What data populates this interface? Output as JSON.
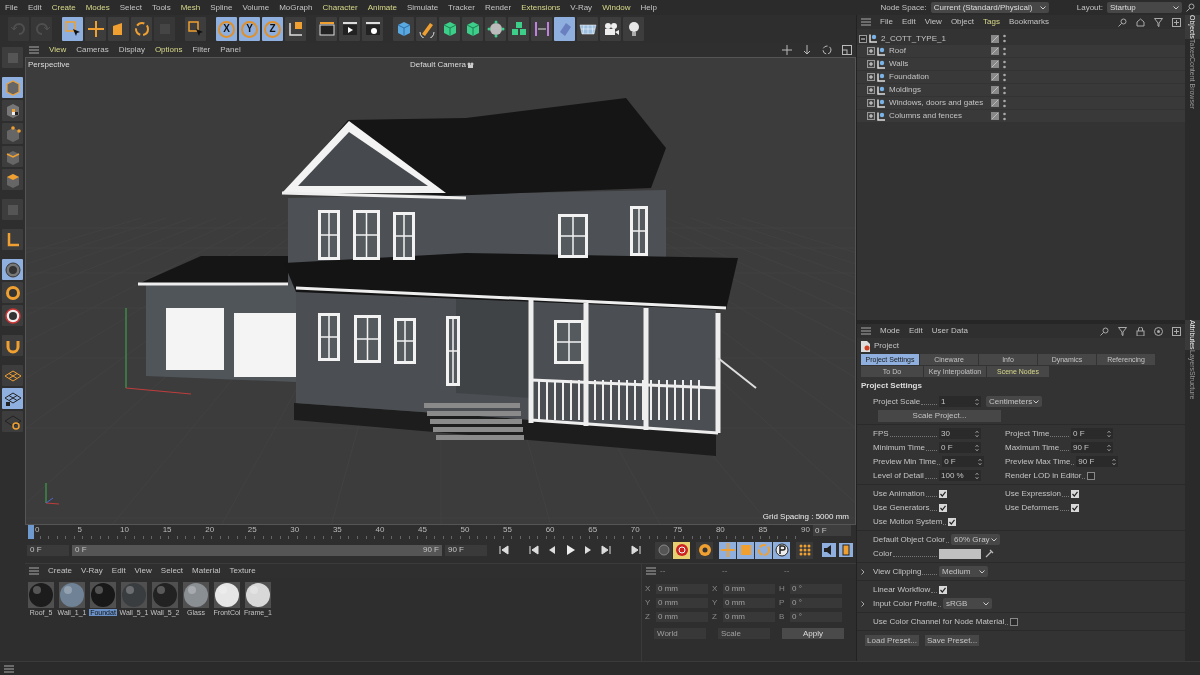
{
  "menu_bar": {
    "items": [
      {
        "label": "File",
        "highlighted": false
      },
      {
        "label": "Edit",
        "highlighted": false
      },
      {
        "label": "Create",
        "highlighted": true
      },
      {
        "label": "Modes",
        "highlighted": true
      },
      {
        "label": "Select",
        "highlighted": false
      },
      {
        "label": "Tools",
        "highlighted": false
      },
      {
        "label": "Mesh",
        "highlighted": true
      },
      {
        "label": "Spline",
        "highlighted": false
      },
      {
        "label": "Volume",
        "highlighted": false
      },
      {
        "label": "MoGraph",
        "highlighted": false
      },
      {
        "label": "Character",
        "highlighted": true
      },
      {
        "label": "Animate",
        "highlighted": true
      },
      {
        "label": "Simulate",
        "highlighted": false
      },
      {
        "label": "Tracker",
        "highlighted": false
      },
      {
        "label": "Render",
        "highlighted": false
      },
      {
        "label": "Extensions",
        "highlighted": true
      },
      {
        "label": "V-Ray",
        "highlighted": false
      },
      {
        "label": "Window",
        "highlighted": true
      },
      {
        "label": "Help",
        "highlighted": false
      }
    ]
  },
  "node_space": {
    "label": "Node Space:",
    "value": "Current (Standard/Physical)"
  },
  "layout": {
    "label": "Layout:",
    "value": "Startup"
  },
  "toolbar": [
    {
      "kind": "undo",
      "selected": false,
      "disabled": true
    },
    {
      "kind": "redo",
      "selected": false,
      "disabled": true
    },
    {
      "kind": "select",
      "selected": true,
      "disabled": false
    },
    {
      "kind": "move",
      "selected": false,
      "disabled": false
    },
    {
      "kind": "scale",
      "selected": false,
      "disabled": false
    },
    {
      "kind": "rotate",
      "selected": false,
      "disabled": false
    },
    {
      "kind": "recent",
      "selected": false,
      "disabled": true
    },
    {
      "kind": "select",
      "selected": false,
      "disabled": false
    },
    {
      "kind": "axis",
      "label": "X",
      "selected": true,
      "disabled": false
    },
    {
      "kind": "axis",
      "label": "Y",
      "selected": true,
      "disabled": false
    },
    {
      "kind": "axis",
      "label": "Z",
      "selected": true,
      "disabled": false
    },
    {
      "kind": "coords",
      "selected": false,
      "disabled": false
    },
    {
      "kind": "clapper",
      "selected": false,
      "disabled": false
    },
    {
      "kind": "render",
      "selected": false,
      "disabled": false
    },
    {
      "kind": "render-settings",
      "selected": false,
      "disabled": false
    },
    {
      "kind": "cube",
      "selected": false,
      "disabled": false
    },
    {
      "kind": "pen",
      "selected": false,
      "disabled": false
    },
    {
      "kind": "green-cube",
      "selected": false,
      "disabled": false
    },
    {
      "kind": "green-cube",
      "selected": false,
      "disabled": false
    },
    {
      "kind": "cloner",
      "selected": false,
      "disabled": false
    },
    {
      "kind": "green-cubes",
      "selected": false,
      "disabled": false
    },
    {
      "kind": "symmetry",
      "selected": false,
      "disabled": false
    },
    {
      "kind": "deformer",
      "selected": true,
      "disabled": false
    },
    {
      "kind": "floor",
      "selected": false,
      "disabled": false
    },
    {
      "kind": "camera",
      "selected": false,
      "disabled": false
    },
    {
      "kind": "light",
      "selected": false,
      "disabled": false
    }
  ],
  "left_toolbar": [
    {
      "kind": "recent",
      "selected": false
    },
    {
      "kind": "model",
      "selected": true
    },
    {
      "kind": "texture",
      "selected": false
    },
    {
      "kind": "points",
      "selected": false
    },
    {
      "kind": "edges",
      "selected": false
    },
    {
      "kind": "polygons",
      "selected": false
    },
    {
      "kind": "recent",
      "selected": false
    },
    {
      "kind": "axis",
      "selected": false
    },
    {
      "kind": "snap-grey",
      "selected": true
    },
    {
      "kind": "snap",
      "selected": false
    },
    {
      "kind": "snap-white",
      "selected": false
    },
    {
      "kind": "magnet",
      "selected": false
    },
    {
      "kind": "workplane",
      "selected": false
    },
    {
      "kind": "workplane-lock",
      "selected": true
    },
    {
      "kind": "workplane-rotate",
      "selected": false
    }
  ],
  "viewport": {
    "menu": [
      {
        "label": "View",
        "highlighted": true
      },
      {
        "label": "Cameras",
        "highlighted": false
      },
      {
        "label": "Display",
        "highlighted": false
      },
      {
        "label": "Options",
        "highlighted": true
      },
      {
        "label": "Filter",
        "highlighted": false
      },
      {
        "label": "Panel",
        "highlighted": false
      }
    ],
    "view_name": "Perspective",
    "camera": "Default Camera",
    "grid_spacing": "Grid Spacing : 5000 mm"
  },
  "timeline": {
    "ticks": [
      "0",
      "5",
      "10",
      "15",
      "20",
      "25",
      "30",
      "35",
      "40",
      "45",
      "50",
      "55",
      "60",
      "65",
      "70",
      "75",
      "80",
      "85",
      "90"
    ],
    "level": 0,
    "current_frame": "0 F",
    "start": "0 F",
    "range": {
      "start": "0 F",
      "end": "90 F",
      "level": 1
    },
    "end": "90 F",
    "key_buttons": [
      {
        "kind": "record",
        "selected": false
      },
      {
        "kind": "autokey",
        "selected": true
      },
      {
        "kind": "keyset",
        "selected": false
      },
      {
        "kind": "move",
        "selected": true
      },
      {
        "kind": "scale",
        "selected": true
      },
      {
        "kind": "rotate",
        "selected": true
      },
      {
        "kind": "param",
        "selected": true
      },
      {
        "kind": "pla",
        "selected": false
      }
    ]
  },
  "materials": {
    "menu": [
      "Create",
      "V-Ray",
      "Edit",
      "View",
      "Select",
      "Material",
      "Texture"
    ],
    "items": [
      {
        "name": "Roof_5",
        "color": "#1c1c1c",
        "selected": false
      },
      {
        "name": "Wall_1_1",
        "color": "#6f8296",
        "selected": false
      },
      {
        "name": "Foundat",
        "color": "#181818",
        "selected": true
      },
      {
        "name": "Wall_5_1",
        "color": "#3a3d40",
        "selected": false
      },
      {
        "name": "Wall_5_2",
        "color": "#222222",
        "selected": false
      },
      {
        "name": "Glass",
        "color": "#8a8f94",
        "selected": false
      },
      {
        "name": "FrontCol",
        "color": "#e6e6e6",
        "selected": false
      },
      {
        "name": "Frame_1",
        "color": "#d8d8d8",
        "selected": false
      }
    ]
  },
  "coordinates": {
    "headers": [
      "--",
      "--",
      "--"
    ],
    "rows": [
      {
        "axis_1": "X",
        "position": "0 mm",
        "axis_2": "X",
        "size": "0 mm",
        "axis_3": "H",
        "rotation": "0 °"
      },
      {
        "axis_1": "Y",
        "position": "0 mm",
        "axis_2": "Y",
        "size": "0 mm",
        "axis_3": "P",
        "rotation": "0 °"
      },
      {
        "axis_1": "Z",
        "position": "0 mm",
        "axis_2": "Z",
        "size": "0 mm",
        "axis_3": "B",
        "rotation": "0 °"
      }
    ],
    "mode_1": "World",
    "mode_2": "Scale",
    "apply": "Apply"
  },
  "objects": {
    "menu": [
      {
        "label": "File",
        "highlighted": false
      },
      {
        "label": "Edit",
        "highlighted": false
      },
      {
        "label": "View",
        "highlighted": false
      },
      {
        "label": "Object",
        "highlighted": false
      },
      {
        "label": "Tags",
        "highlighted": true
      },
      {
        "label": "Bookmarks",
        "highlighted": false
      }
    ],
    "tree": [
      {
        "name": "2_COTT_TYPE_1",
        "expanded": true,
        "children": [
          {
            "name": "Roof",
            "expanded": false
          },
          {
            "name": "Walls",
            "expanded": false
          },
          {
            "name": "Foundation",
            "expanded": false
          },
          {
            "name": "Moldings",
            "expanded": false
          },
          {
            "name": "Windows, doors and gates",
            "expanded": false
          },
          {
            "name": "Columns and fences",
            "expanded": false
          }
        ]
      }
    ]
  },
  "attributes": {
    "menu": [
      "Mode",
      "Edit",
      "User Data"
    ],
    "title": "Project",
    "tabs_row_1": [
      {
        "label": "Project Settings",
        "selected": true
      },
      {
        "label": "Cineware",
        "selected": false
      },
      {
        "label": "Info",
        "selected": false
      },
      {
        "label": "Dynamics",
        "selected": false
      },
      {
        "label": "Referencing",
        "selected": false
      }
    ],
    "tabs_row_2": [
      {
        "label": "To Do",
        "selected": false,
        "highlighted": false
      },
      {
        "label": "Key Interpolation",
        "selected": false,
        "highlighted": false
      },
      {
        "label": "Scene Nodes",
        "selected": false,
        "highlighted": true
      }
    ],
    "section": "Project Settings",
    "groups": [
      [
        [
          {
            "kind": "number_unit",
            "label": "Project Scale",
            "value": "1",
            "unit": "Centimeters"
          }
        ],
        [
          {
            "kind": "button",
            "label": "Scale Project..."
          }
        ]
      ],
      [
        [
          {
            "kind": "number",
            "label": "FPS",
            "value": "30"
          },
          {
            "kind": "number",
            "label": "Project Time",
            "value": "0 F"
          }
        ],
        [
          {
            "kind": "number",
            "label": "Minimum Time",
            "value": "0 F"
          },
          {
            "kind": "number",
            "label": "Maximum Time",
            "value": "90 F"
          }
        ],
        [
          {
            "kind": "number",
            "label": "Preview Min Time",
            "value": "0 F"
          },
          {
            "kind": "number",
            "label": "Preview Max Time",
            "value": "90 F"
          }
        ],
        [
          {
            "kind": "number",
            "label": "Level of Detail",
            "value": "100 %"
          },
          {
            "kind": "checkbox",
            "label": "Render LOD in Editor",
            "checked": false
          }
        ]
      ],
      [
        [
          {
            "kind": "checkbox",
            "label": "Use Animation",
            "checked": true
          },
          {
            "kind": "checkbox",
            "label": "Use Expression",
            "checked": true
          }
        ],
        [
          {
            "kind": "checkbox",
            "label": "Use Generators",
            "checked": true
          },
          {
            "kind": "checkbox",
            "label": "Use Deformers",
            "checked": true
          }
        ],
        [
          {
            "kind": "checkbox",
            "label": "Use Motion System",
            "checked": true
          }
        ]
      ],
      [
        [
          {
            "kind": "dropdown",
            "label": "Default Object Color",
            "value": "60% Gray"
          }
        ],
        [
          {
            "kind": "color",
            "label": "Color"
          }
        ]
      ],
      [
        [
          {
            "kind": "dropdown",
            "label": "View Clipping",
            "value": "Medium",
            "expandable": true
          }
        ]
      ],
      [
        [
          {
            "kind": "checkbox",
            "label": "Linear Workflow",
            "checked": true
          }
        ],
        [
          {
            "kind": "dropdown",
            "label": "Input Color Profile",
            "value": "sRGB",
            "expandable": true
          }
        ]
      ],
      [
        [
          {
            "kind": "checkbox",
            "label": "Use Color Channel for Node Material",
            "checked": false
          }
        ]
      ]
    ],
    "presets": [
      "Load Preset...",
      "Save Preset..."
    ]
  },
  "side_tabs_top": [
    {
      "label": "Objects",
      "selected": true
    },
    {
      "label": "Takes",
      "selected": false
    },
    {
      "label": "Content Browser",
      "selected": false
    }
  ],
  "side_tabs_bottom": [
    {
      "label": "Attributes",
      "selected": true
    },
    {
      "label": "Layers",
      "selected": false
    },
    {
      "label": "Structure",
      "selected": false
    }
  ]
}
